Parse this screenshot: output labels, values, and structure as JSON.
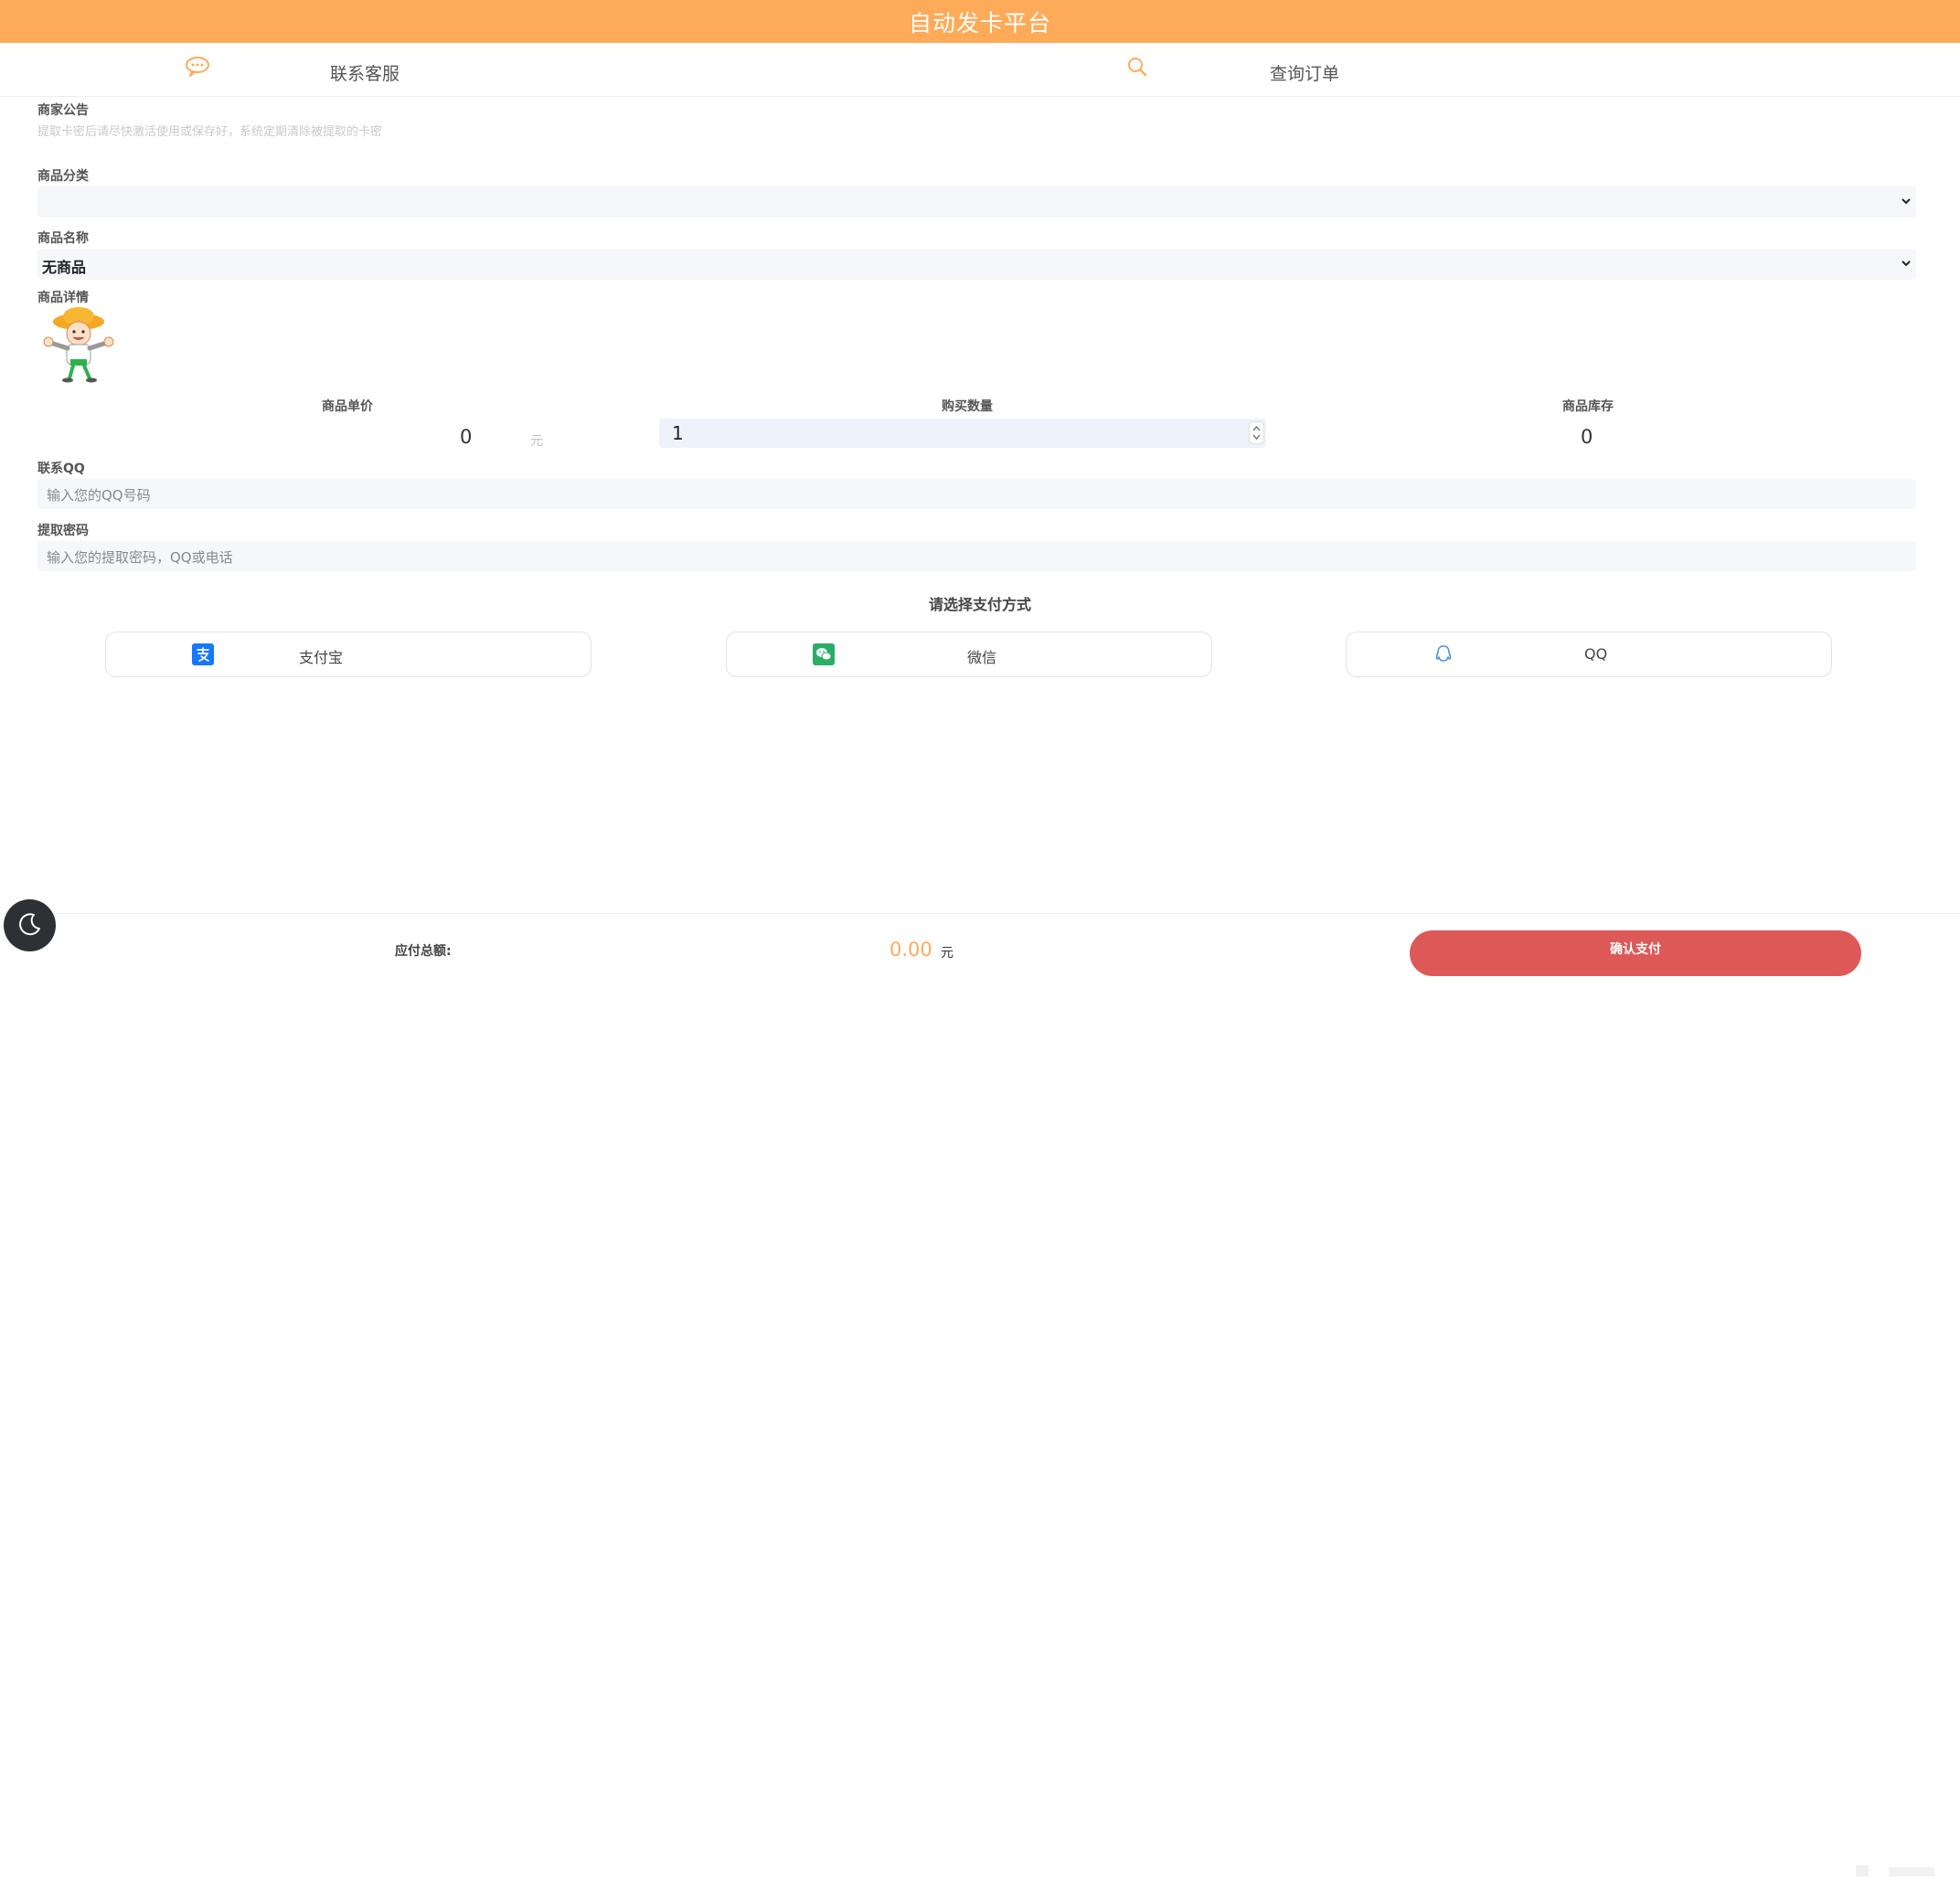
{
  "header": {
    "title": "自动发卡平台"
  },
  "nav": {
    "contact_label": "联系客服",
    "contact_icon": "chat-bubble-icon",
    "query_label": "查询订单",
    "query_icon": "search-icon"
  },
  "notice": {
    "label": "商家公告",
    "text": "提取卡密后请尽快激活使用或保存好，系统定期清除被提取的卡密"
  },
  "category": {
    "label": "商品分类",
    "value": ""
  },
  "product": {
    "label": "商品名称",
    "value": "无商品"
  },
  "details": {
    "label": "商品详情"
  },
  "pricing": {
    "price_label": "商品单价",
    "price_value": "0",
    "price_unit": "元",
    "qty_label": "购买数量",
    "qty_value": "1",
    "stock_label": "商品库存",
    "stock_value": "0"
  },
  "contact_qq": {
    "label": "联系QQ",
    "placeholder": "输入您的QQ号码"
  },
  "password": {
    "label": "提取密码",
    "placeholder": "输入您的提取密码，QQ或电话"
  },
  "payment": {
    "title": "请选择支付方式",
    "methods": [
      {
        "label": "支付宝",
        "icon": "alipay-icon"
      },
      {
        "label": "微信",
        "icon": "wechat-icon"
      },
      {
        "label": "QQ",
        "icon": "qq-icon"
      }
    ]
  },
  "footer": {
    "total_label": "应付总额:",
    "total_amount": "0.00",
    "total_unit": "元",
    "confirm_label": "确认支付"
  },
  "colors": {
    "brand_orange": "#fdab58",
    "confirm_red": "#dc5957",
    "alipay_blue": "#1677ff",
    "wechat_green": "#2aae67",
    "qq_blue": "#4a90e2"
  }
}
